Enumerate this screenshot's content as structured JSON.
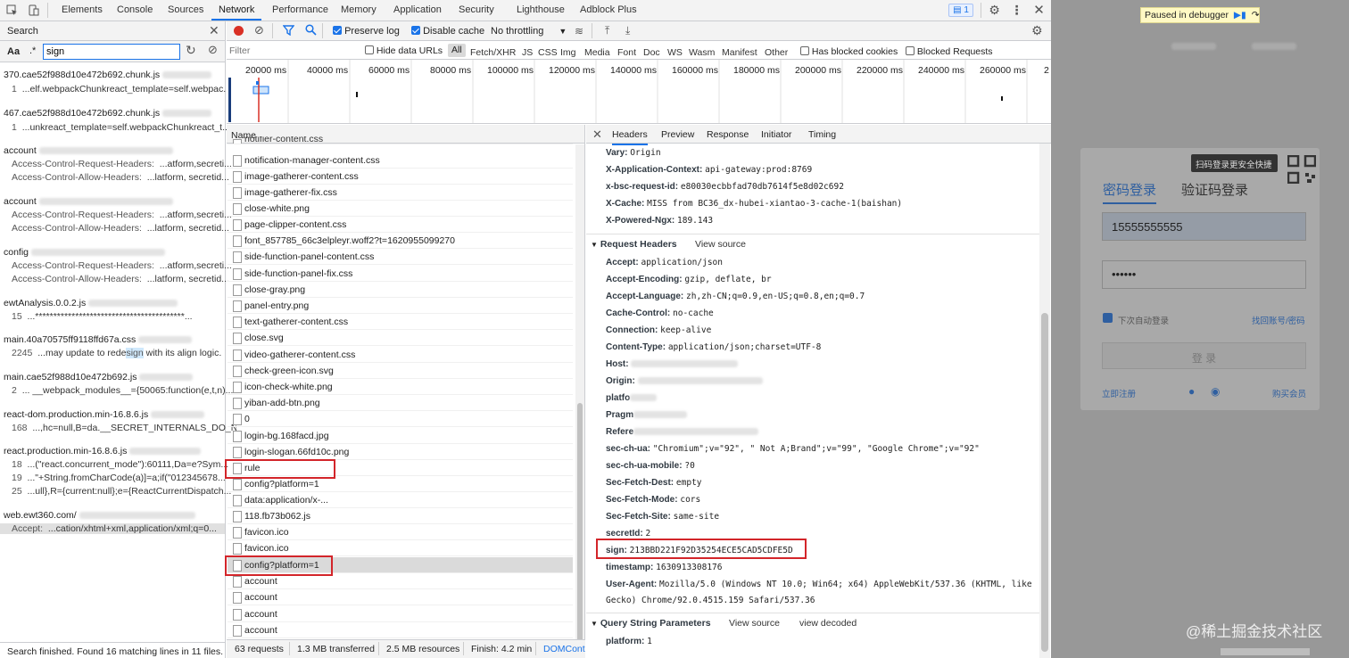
{
  "devtools": {
    "tabs": [
      "Elements",
      "Console",
      "Sources",
      "Network",
      "Performance",
      "Memory",
      "Application",
      "Security",
      "Lighthouse",
      "Adblock Plus"
    ],
    "issues_count": "1"
  },
  "search": {
    "title": "Search",
    "case_label": "Aa",
    "regex_label": ".*",
    "query": "sign",
    "results": [
      {
        "file": "370.cae52f988d10e472b692.chunk.js",
        "lines": [
          {
            "n": "1",
            "text": "...elf.webpackChunkreact_template=self.webpac..."
          }
        ]
      },
      {
        "file": "467.cae52f988d10e472b692.chunk.js",
        "lines": [
          {
            "n": "1",
            "text": "...unkreact_template=self.webpackChunkreact_t..."
          }
        ]
      },
      {
        "file": "account",
        "lines": [
          {
            "n": "Access-Control-Request-Headers:",
            "text": "...atform,secreti..."
          },
          {
            "n": "Access-Control-Allow-Headers:",
            "text": "...latform, secretid..."
          }
        ]
      },
      {
        "file": "account",
        "lines": [
          {
            "n": "Access-Control-Request-Headers:",
            "text": "...atform,secreti..."
          },
          {
            "n": "Access-Control-Allow-Headers:",
            "text": "...latform, secretid..."
          }
        ]
      },
      {
        "file": "config",
        "lines": [
          {
            "n": "Access-Control-Request-Headers:",
            "text": "...atform,secreti..."
          },
          {
            "n": "Access-Control-Allow-Headers:",
            "text": "...latform, secretid..."
          }
        ]
      },
      {
        "file": "ewtAnalysis.0.0.2.js",
        "lines": [
          {
            "n": "15",
            "text": "...*****************************************..."
          }
        ]
      },
      {
        "file": "main.40a70575ff9118ffd67a.css",
        "lines": [
          {
            "n": "2245",
            "text": "...may update to rede",
            "hl": "sign",
            "post": " with its align logic."
          }
        ]
      },
      {
        "file": "main.cae52f988d10e472b692.js",
        "lines": [
          {
            "n": "2",
            "text": "... __webpack_modules__={50065:function(e,t,n)..."
          }
        ]
      },
      {
        "file": "react-dom.production.min-16.8.6.js",
        "lines": [
          {
            "n": "168",
            "text": "...,hc=null,B=da.__SECRET_INTERNALS_DO_N..."
          }
        ]
      },
      {
        "file": "react.production.min-16.8.6.js",
        "lines": [
          {
            "n": "18",
            "text": "...(\"react.concurrent_mode\"):60111,Da=e?Sym..."
          },
          {
            "n": "19",
            "text": "...\"+String.fromCharCode(a)]=a;if(\"012345678..."
          },
          {
            "n": "25",
            "text": "...ull},R={current:null};e={ReactCurrentDispatch..."
          }
        ]
      },
      {
        "file": "web.ewt360.com/",
        "lines": [
          {
            "n": "Accept:",
            "text": "...cation/xhtml+xml,application/xml;q=0..."
          }
        ]
      }
    ],
    "status": "Search finished.  Found 16 matching lines in 11 files."
  },
  "network": {
    "preserve_log": "Preserve log",
    "disable_cache": "Disable cache",
    "throttling": "No throttling",
    "filter_placeholder": "Filter",
    "hide_data_urls": "Hide data URLs",
    "types": [
      "All",
      "Fetch/XHR",
      "JS",
      "CSS",
      "Img",
      "Media",
      "Font",
      "Doc",
      "WS",
      "Wasm",
      "Manifest",
      "Other"
    ],
    "has_blocked_cookies": "Has blocked cookies",
    "blocked_requests": "Blocked Requests",
    "timeline_ticks": [
      "20000 ms",
      "40000 ms",
      "60000 ms",
      "80000 ms",
      "100000 ms",
      "120000 ms",
      "140000 ms",
      "160000 ms",
      "180000 ms",
      "200000 ms",
      "220000 ms",
      "240000 ms",
      "260000 ms",
      "2"
    ],
    "name_header": "Name",
    "requests": [
      "notifier-content.css",
      "notification-manager-content.css",
      "image-gatherer-content.css",
      "image-gatherer-fix.css",
      "close-white.png",
      "page-clipper-content.css",
      "font_857785_66c3elpleyr.woff2?t=1620955099270",
      "side-function-panel-content.css",
      "side-function-panel-fix.css",
      "close-gray.png",
      "panel-entry.png",
      "text-gatherer-content.css",
      "close.svg",
      "video-gatherer-content.css",
      "check-green-icon.svg",
      "icon-check-white.png",
      "yiban-add-btn.png",
      "0",
      "login-bg.168facd.jpg",
      "login-slogan.66fd10c.png",
      "rule",
      "config?platform=1",
      "data:application/x-...",
      "118.fb73b062.js",
      "favicon.ico",
      "favicon.ico",
      "config?platform=1",
      "account",
      "account",
      "account",
      "account"
    ],
    "status": [
      "63 requests",
      "1.3 MB transferred",
      "2.5 MB resources",
      "Finish: 4.2 min",
      "DOMCont"
    ]
  },
  "details": {
    "tabs": [
      "Headers",
      "Preview",
      "Response",
      "Initiator",
      "Timing"
    ],
    "response_headers": [
      {
        "k": "Vary:",
        "v": "Origin"
      },
      {
        "k": "X-Application-Context:",
        "v": "api-gateway:prod:8769"
      },
      {
        "k": "x-bsc-request-id:",
        "v": "e80030ecbbfad70db7614f5e8d02c692"
      },
      {
        "k": "X-Cache:",
        "v": "MISS from BC36_dx-hubei-xiantao-3-cache-1(baishan)"
      },
      {
        "k": "X-Powered-Ngx:",
        "v": "189.143"
      }
    ],
    "request_title": "Request Headers",
    "view_source": "View source",
    "request_headers": [
      {
        "k": "Accept:",
        "v": "application/json"
      },
      {
        "k": "Accept-Encoding:",
        "v": "gzip, deflate, br"
      },
      {
        "k": "Accept-Language:",
        "v": "zh,zh-CN;q=0.9,en-US;q=0.8,en;q=0.7"
      },
      {
        "k": "Cache-Control:",
        "v": "no-cache"
      },
      {
        "k": "Connection:",
        "v": "keep-alive"
      },
      {
        "k": "Content-Type:",
        "v": "application/json;charset=UTF-8"
      },
      {
        "k": "Host:",
        "v": ""
      },
      {
        "k": "Origin:",
        "v": ""
      },
      {
        "k": "platfo",
        "v": ""
      },
      {
        "k": "Pragm",
        "v": ""
      },
      {
        "k": "Refere",
        "v": ""
      },
      {
        "k": "sec-ch-ua:",
        "v": "\"Chromium\";v=\"92\", \" Not A;Brand\";v=\"99\", \"Google Chrome\";v=\"92\""
      },
      {
        "k": "sec-ch-ua-mobile:",
        "v": "?0"
      },
      {
        "k": "Sec-Fetch-Dest:",
        "v": "empty"
      },
      {
        "k": "Sec-Fetch-Mode:",
        "v": "cors"
      },
      {
        "k": "Sec-Fetch-Site:",
        "v": "same-site"
      },
      {
        "k": "secretId:",
        "v": "2"
      },
      {
        "k": "sign:",
        "v": "213BBD221F92D35254ECE5CAD5CDFE5D"
      },
      {
        "k": "timestamp:",
        "v": "1630913308176"
      },
      {
        "k": "User-Agent:",
        "v": "Mozilla/5.0 (Windows NT 10.0; Win64; x64) AppleWebKit/537.36 (KHTML, like"
      },
      {
        "k": "",
        "v": "Gecko) Chrome/92.0.4515.159 Safari/537.36"
      }
    ],
    "query_title": "Query String Parameters",
    "view_decoded": "view decoded",
    "query_params": [
      {
        "k": "platform:",
        "v": "1"
      }
    ]
  },
  "page": {
    "paused": "Paused in debugger",
    "qr_tip": "扫码登录更安全快捷",
    "tab_password": "密码登录",
    "tab_code": "验证码登录",
    "phone": "15555555555",
    "password": "••••••",
    "remember": "下次自动登录",
    "forgot": "找回账号/密码",
    "login": "登 录",
    "register": "立即注册",
    "buy": "购买会员",
    "watermark": "@稀土掘金技术社区"
  }
}
